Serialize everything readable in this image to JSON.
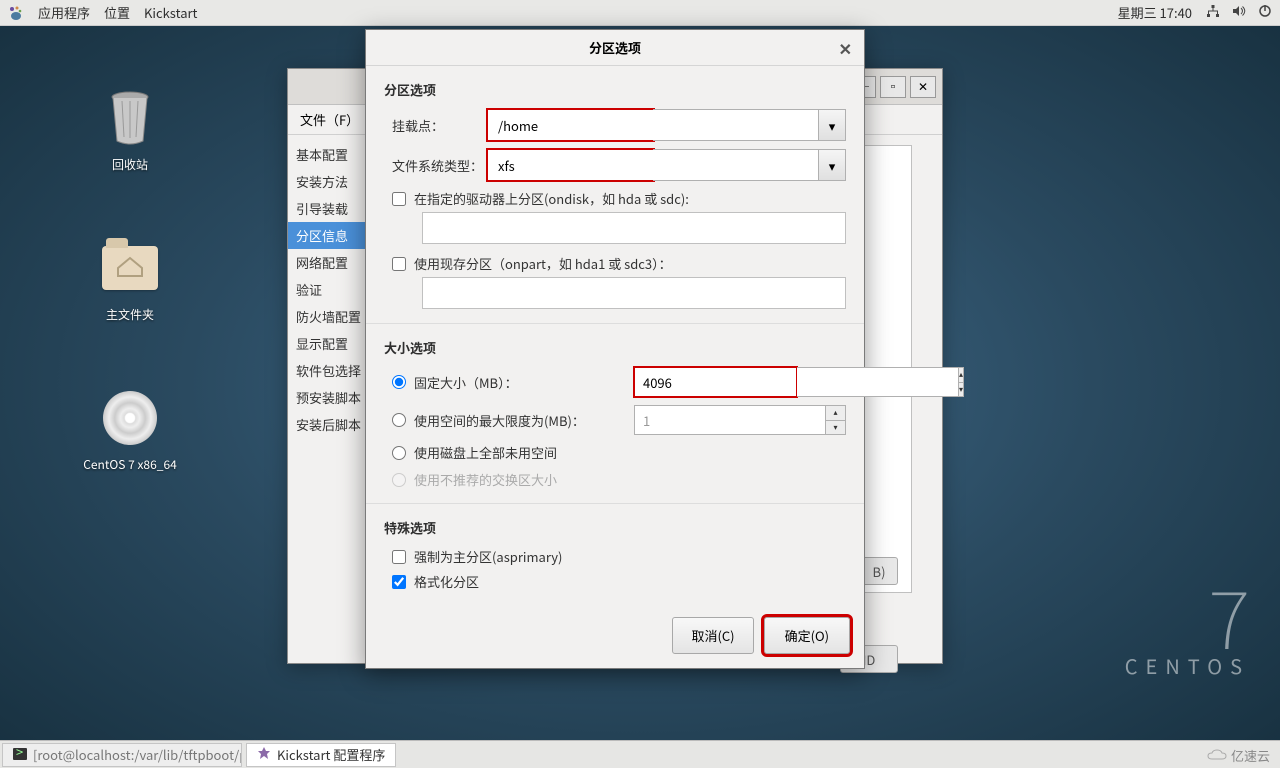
{
  "topbar": {
    "apps": "应用程序",
    "places": "位置",
    "appname": "Kickstart",
    "datetime": "星期三 17:40"
  },
  "desktop": {
    "trash": "回收站",
    "home": "主文件夹",
    "disc": "CentOS 7 x86_64"
  },
  "centos": {
    "seven": "7",
    "word": "CENTOS"
  },
  "config": {
    "menu_file": "文件（F）",
    "sidebar": [
      "基本配置",
      "安装方法",
      "引导装载",
      "分区信息",
      "网络配置",
      "验证",
      "防火墙配置",
      "显示配置",
      "软件包选择",
      "预安装脚本",
      "安装后脚本"
    ],
    "selected_index": 3,
    "bg_btn1": "B)",
    "bg_btn2": "ID"
  },
  "dialog": {
    "title": "分区选项",
    "section1": "分区选项",
    "mount_label": "挂载点：",
    "mount_value": "/home",
    "fs_label": "文件系统类型：",
    "fs_value": "xfs",
    "ondisk_label": "在指定的驱动器上分区(ondisk，如 hda 或 sdc):",
    "onpart_label": "使用现存分区（onpart，如 hda1 或 sdc3）：",
    "section2": "大小选项",
    "fixed_label": "固定大小（MB）：",
    "fixed_value": "4096",
    "max_label": "使用空间的最大限度为(MB)：",
    "max_value": "1",
    "fill_label": "使用磁盘上全部未用空间",
    "swap_label": "使用不推荐的交换区大小",
    "section3": "特殊选项",
    "asprimary": "强制为主分区(asprimary)",
    "format": "格式化分区",
    "cancel": "取消(C)",
    "ok": "确定(O)"
  },
  "taskbar": {
    "task1": "[root@localhost:/var/lib/tftpboot/p…",
    "task2": "Kickstart 配置程序"
  },
  "watermark": "亿速云"
}
